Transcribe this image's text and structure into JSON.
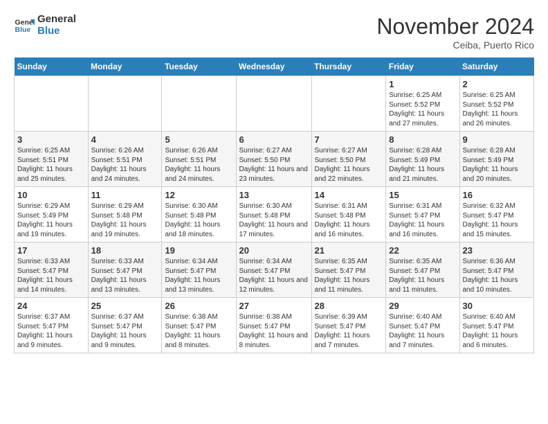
{
  "header": {
    "logo_line1": "General",
    "logo_line2": "Blue",
    "month_title": "November 2024",
    "location": "Ceiba, Puerto Rico"
  },
  "weekdays": [
    "Sunday",
    "Monday",
    "Tuesday",
    "Wednesday",
    "Thursday",
    "Friday",
    "Saturday"
  ],
  "weeks": [
    [
      {
        "day": "",
        "info": ""
      },
      {
        "day": "",
        "info": ""
      },
      {
        "day": "",
        "info": ""
      },
      {
        "day": "",
        "info": ""
      },
      {
        "day": "",
        "info": ""
      },
      {
        "day": "1",
        "info": "Sunrise: 6:25 AM\nSunset: 5:52 PM\nDaylight: 11 hours and 27 minutes."
      },
      {
        "day": "2",
        "info": "Sunrise: 6:25 AM\nSunset: 5:52 PM\nDaylight: 11 hours and 26 minutes."
      }
    ],
    [
      {
        "day": "3",
        "info": "Sunrise: 6:25 AM\nSunset: 5:51 PM\nDaylight: 11 hours and 25 minutes."
      },
      {
        "day": "4",
        "info": "Sunrise: 6:26 AM\nSunset: 5:51 PM\nDaylight: 11 hours and 24 minutes."
      },
      {
        "day": "5",
        "info": "Sunrise: 6:26 AM\nSunset: 5:51 PM\nDaylight: 11 hours and 24 minutes."
      },
      {
        "day": "6",
        "info": "Sunrise: 6:27 AM\nSunset: 5:50 PM\nDaylight: 11 hours and 23 minutes."
      },
      {
        "day": "7",
        "info": "Sunrise: 6:27 AM\nSunset: 5:50 PM\nDaylight: 11 hours and 22 minutes."
      },
      {
        "day": "8",
        "info": "Sunrise: 6:28 AM\nSunset: 5:49 PM\nDaylight: 11 hours and 21 minutes."
      },
      {
        "day": "9",
        "info": "Sunrise: 6:28 AM\nSunset: 5:49 PM\nDaylight: 11 hours and 20 minutes."
      }
    ],
    [
      {
        "day": "10",
        "info": "Sunrise: 6:29 AM\nSunset: 5:49 PM\nDaylight: 11 hours and 19 minutes."
      },
      {
        "day": "11",
        "info": "Sunrise: 6:29 AM\nSunset: 5:48 PM\nDaylight: 11 hours and 19 minutes."
      },
      {
        "day": "12",
        "info": "Sunrise: 6:30 AM\nSunset: 5:48 PM\nDaylight: 11 hours and 18 minutes."
      },
      {
        "day": "13",
        "info": "Sunrise: 6:30 AM\nSunset: 5:48 PM\nDaylight: 11 hours and 17 minutes."
      },
      {
        "day": "14",
        "info": "Sunrise: 6:31 AM\nSunset: 5:48 PM\nDaylight: 11 hours and 16 minutes."
      },
      {
        "day": "15",
        "info": "Sunrise: 6:31 AM\nSunset: 5:47 PM\nDaylight: 11 hours and 16 minutes."
      },
      {
        "day": "16",
        "info": "Sunrise: 6:32 AM\nSunset: 5:47 PM\nDaylight: 11 hours and 15 minutes."
      }
    ],
    [
      {
        "day": "17",
        "info": "Sunrise: 6:33 AM\nSunset: 5:47 PM\nDaylight: 11 hours and 14 minutes."
      },
      {
        "day": "18",
        "info": "Sunrise: 6:33 AM\nSunset: 5:47 PM\nDaylight: 11 hours and 13 minutes."
      },
      {
        "day": "19",
        "info": "Sunrise: 6:34 AM\nSunset: 5:47 PM\nDaylight: 11 hours and 13 minutes."
      },
      {
        "day": "20",
        "info": "Sunrise: 6:34 AM\nSunset: 5:47 PM\nDaylight: 11 hours and 12 minutes."
      },
      {
        "day": "21",
        "info": "Sunrise: 6:35 AM\nSunset: 5:47 PM\nDaylight: 11 hours and 11 minutes."
      },
      {
        "day": "22",
        "info": "Sunrise: 6:35 AM\nSunset: 5:47 PM\nDaylight: 11 hours and 11 minutes."
      },
      {
        "day": "23",
        "info": "Sunrise: 6:36 AM\nSunset: 5:47 PM\nDaylight: 11 hours and 10 minutes."
      }
    ],
    [
      {
        "day": "24",
        "info": "Sunrise: 6:37 AM\nSunset: 5:47 PM\nDaylight: 11 hours and 9 minutes."
      },
      {
        "day": "25",
        "info": "Sunrise: 6:37 AM\nSunset: 5:47 PM\nDaylight: 11 hours and 9 minutes."
      },
      {
        "day": "26",
        "info": "Sunrise: 6:38 AM\nSunset: 5:47 PM\nDaylight: 11 hours and 8 minutes."
      },
      {
        "day": "27",
        "info": "Sunrise: 6:38 AM\nSunset: 5:47 PM\nDaylight: 11 hours and 8 minutes."
      },
      {
        "day": "28",
        "info": "Sunrise: 6:39 AM\nSunset: 5:47 PM\nDaylight: 11 hours and 7 minutes."
      },
      {
        "day": "29",
        "info": "Sunrise: 6:40 AM\nSunset: 5:47 PM\nDaylight: 11 hours and 7 minutes."
      },
      {
        "day": "30",
        "info": "Sunrise: 6:40 AM\nSunset: 5:47 PM\nDaylight: 11 hours and 6 minutes."
      }
    ]
  ]
}
